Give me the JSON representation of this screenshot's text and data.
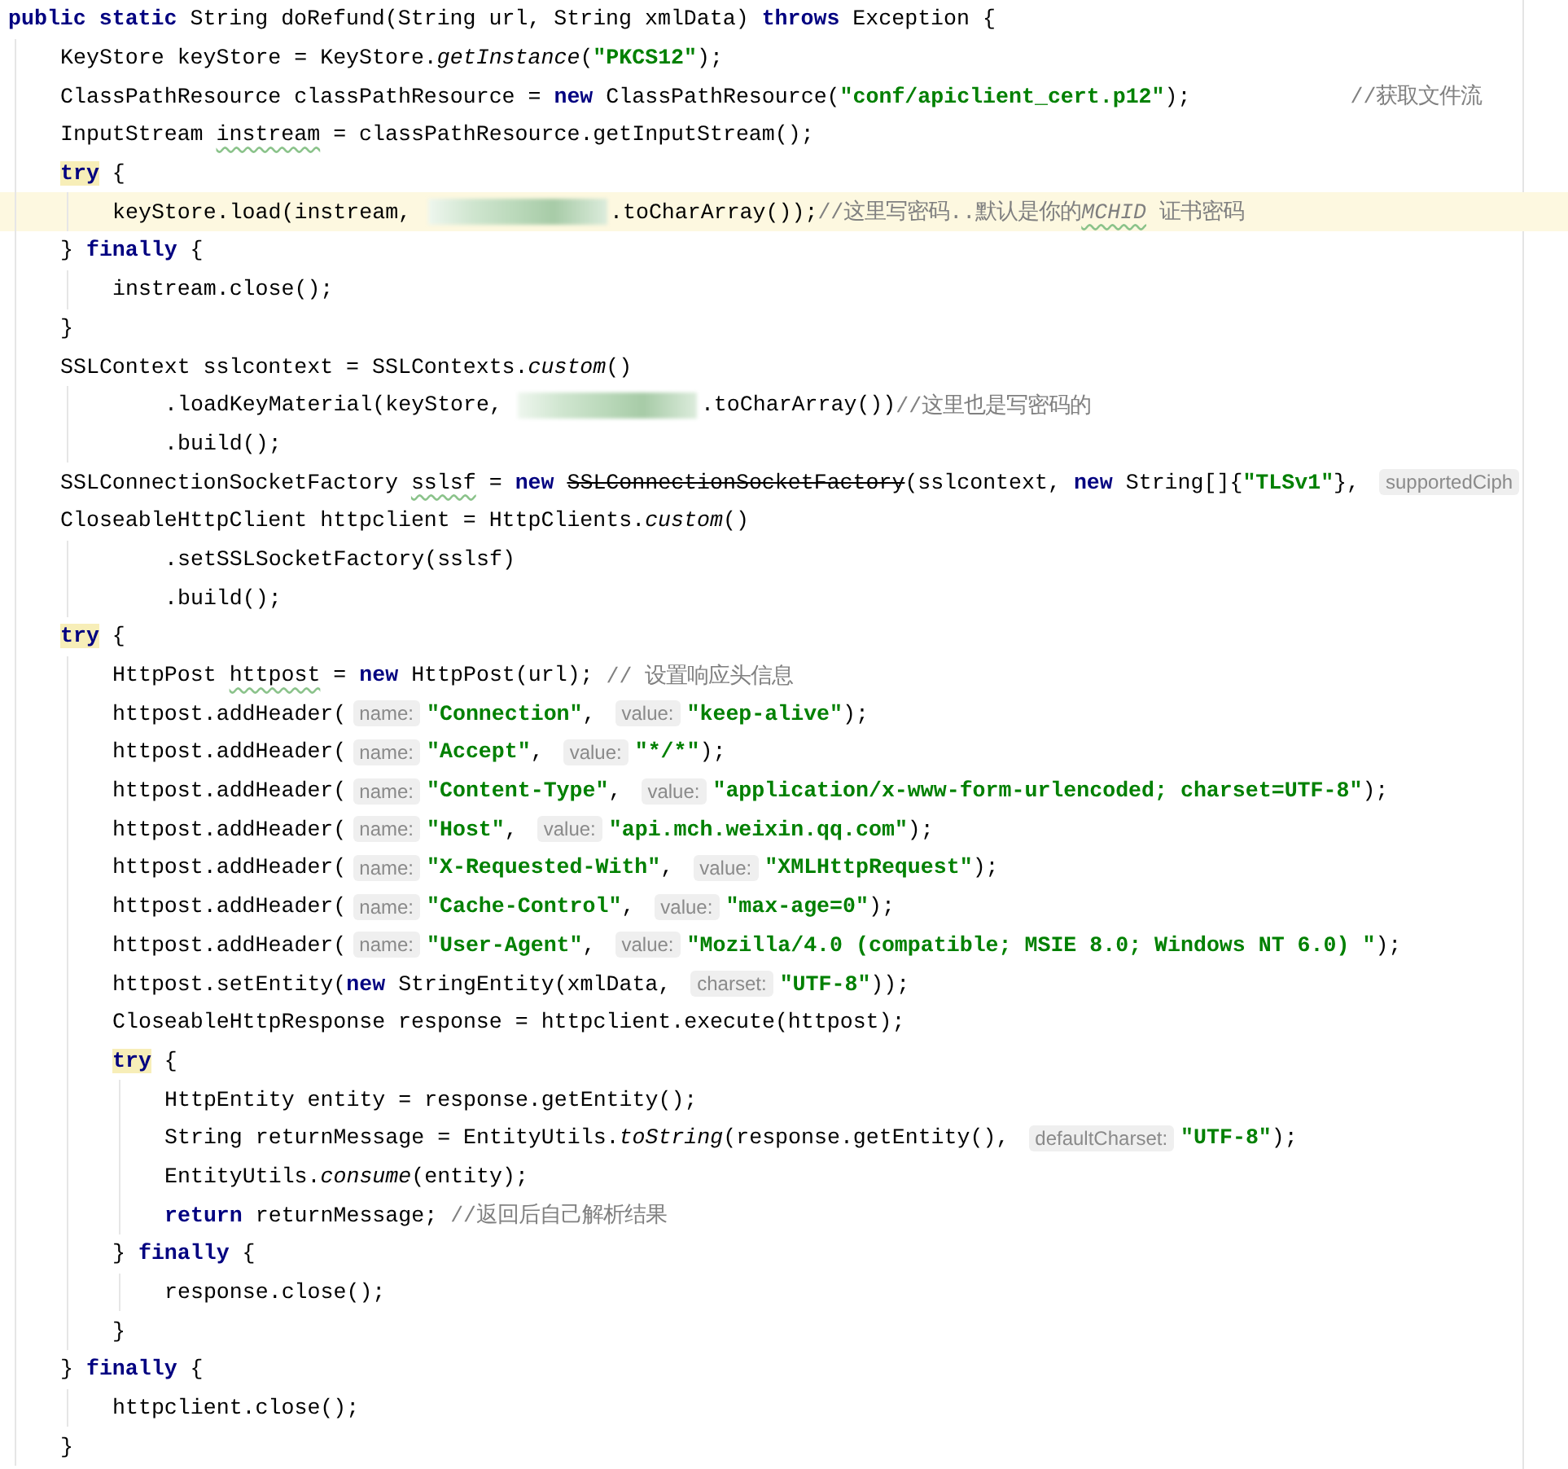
{
  "editor": {
    "lines": [
      {
        "tokens": [
          {
            "kind": "kw",
            "text": "public static"
          },
          {
            "kind": "plain",
            "text": " String doRefund(String url, String xmlData) "
          },
          {
            "kind": "kw",
            "text": "throws"
          },
          {
            "kind": "plain",
            "text": " Exception {"
          }
        ],
        "children": [
          {
            "tokens": [
              {
                "kind": "plain",
                "text": "KeyStore keyStore = KeyStore."
              },
              {
                "kind": "italic",
                "text": "getInstance"
              },
              {
                "kind": "plain",
                "text": "("
              },
              {
                "kind": "str",
                "text": "\"PKCS12\""
              },
              {
                "kind": "plain",
                "text": ");"
              }
            ]
          },
          {
            "tokens": [
              {
                "kind": "plain",
                "text": "ClassPathResource classPathResource = "
              },
              {
                "kind": "kw",
                "text": "new"
              },
              {
                "kind": "plain",
                "text": " ClassPathResource("
              },
              {
                "kind": "str",
                "text": "\"conf/apiclient_cert.p12\""
              },
              {
                "kind": "plain",
                "text": ");"
              },
              {
                "kind": "far-comment",
                "text": "//获取文件流"
              }
            ]
          },
          {
            "tokens": [
              {
                "kind": "plain",
                "text": "InputStream "
              },
              {
                "kind": "plain",
                "text": "instream",
                "squiggle": true
              },
              {
                "kind": "plain",
                "text": " = classPathResource.getInputStream();"
              }
            ]
          },
          {
            "tokens": [
              {
                "kind": "kw",
                "text": "try",
                "matched": true
              },
              {
                "kind": "plain",
                "text": " {"
              }
            ],
            "children": [
              {
                "highlighted": true,
                "tokens": [
                  {
                    "kind": "plain",
                    "text": "keyStore.load(instream, "
                  },
                  {
                    "kind": "redacted"
                  },
                  {
                    "kind": "plain",
                    "text": ".toCharArray());"
                  },
                  {
                    "kind": "comment",
                    "text": "//这里写密码..默认是你的"
                  },
                  {
                    "kind": "comment-italic",
                    "text": "MCHID",
                    "squiggle": true
                  },
                  {
                    "kind": "comment",
                    "text": " 证书密码"
                  }
                ]
              }
            ]
          },
          {
            "tokens": [
              {
                "kind": "plain",
                "text": "} "
              },
              {
                "kind": "kw",
                "text": "finally"
              },
              {
                "kind": "plain",
                "text": " {"
              }
            ],
            "children": [
              {
                "tokens": [
                  {
                    "kind": "plain",
                    "text": "instream.close();"
                  }
                ]
              }
            ]
          },
          {
            "tokens": [
              {
                "kind": "plain",
                "text": "}"
              }
            ]
          },
          {
            "tokens": [
              {
                "kind": "plain",
                "text": "SSLContext sslcontext = SSLContexts."
              },
              {
                "kind": "italic",
                "text": "custom"
              },
              {
                "kind": "plain",
                "text": "()"
              }
            ],
            "children": [
              {
                "kind": "continuation",
                "tokens": [
                  {
                    "kind": "plain",
                    "text": ".loadKeyMaterial(keyStore, "
                  },
                  {
                    "kind": "redacted"
                  },
                  {
                    "kind": "plain",
                    "text": ".toCharArray())"
                  },
                  {
                    "kind": "comment",
                    "text": "//这里也是写密码的"
                  }
                ]
              },
              {
                "kind": "continuation",
                "tokens": [
                  {
                    "kind": "plain",
                    "text": ".build();"
                  }
                ]
              }
            ]
          },
          {
            "tokens": [
              {
                "kind": "plain",
                "text": "SSLConnectionSocketFactory "
              },
              {
                "kind": "plain",
                "text": "sslsf",
                "squiggle": true
              },
              {
                "kind": "plain",
                "text": " = "
              },
              {
                "kind": "kw",
                "text": "new "
              },
              {
                "kind": "deprecated",
                "text": "SSLConnectionSocketFactory"
              },
              {
                "kind": "plain",
                "text": "(sslcontext, "
              },
              {
                "kind": "kw",
                "text": "new"
              },
              {
                "kind": "plain",
                "text": " String[]{"
              },
              {
                "kind": "str",
                "text": "\"TLSv1\""
              },
              {
                "kind": "plain",
                "text": "}, "
              },
              {
                "kind": "hint",
                "text": "supportedCiph"
              }
            ]
          },
          {
            "tokens": [
              {
                "kind": "plain",
                "text": "CloseableHttpClient httpclient = HttpClients."
              },
              {
                "kind": "italic",
                "text": "custom"
              },
              {
                "kind": "plain",
                "text": "()"
              }
            ],
            "children": [
              {
                "kind": "continuation",
                "tokens": [
                  {
                    "kind": "plain",
                    "text": ".setSSLSocketFactory(sslsf)"
                  }
                ]
              },
              {
                "kind": "continuation",
                "tokens": [
                  {
                    "kind": "plain",
                    "text": ".build();"
                  }
                ]
              }
            ]
          },
          {
            "tokens": [
              {
                "kind": "kw",
                "text": "try",
                "matched": true
              },
              {
                "kind": "plain",
                "text": " {"
              }
            ],
            "children": [
              {
                "tokens": [
                  {
                    "kind": "plain",
                    "text": "HttpPost "
                  },
                  {
                    "kind": "plain",
                    "text": "httpost",
                    "squiggle": true
                  },
                  {
                    "kind": "plain",
                    "text": " = "
                  },
                  {
                    "kind": "kw",
                    "text": "new"
                  },
                  {
                    "kind": "plain",
                    "text": " HttpPost(url); "
                  },
                  {
                    "kind": "comment",
                    "text": "// 设置响应头信息"
                  }
                ]
              },
              {
                "tokens": [
                  {
                    "kind": "plain",
                    "text": "httpost.addHeader("
                  },
                  {
                    "kind": "hint",
                    "text": "name:"
                  },
                  {
                    "kind": "str",
                    "text": "\"Connection\""
                  },
                  {
                    "kind": "plain",
                    "text": ", "
                  },
                  {
                    "kind": "hint",
                    "text": "value:"
                  },
                  {
                    "kind": "str",
                    "text": "\"keep-alive\""
                  },
                  {
                    "kind": "plain",
                    "text": ");"
                  }
                ]
              },
              {
                "tokens": [
                  {
                    "kind": "plain",
                    "text": "httpost.addHeader("
                  },
                  {
                    "kind": "hint",
                    "text": "name:"
                  },
                  {
                    "kind": "str",
                    "text": "\"Accept\""
                  },
                  {
                    "kind": "plain",
                    "text": ", "
                  },
                  {
                    "kind": "hint",
                    "text": "value:"
                  },
                  {
                    "kind": "str",
                    "text": "\"*/*\""
                  },
                  {
                    "kind": "plain",
                    "text": ");"
                  }
                ]
              },
              {
                "tokens": [
                  {
                    "kind": "plain",
                    "text": "httpost.addHeader("
                  },
                  {
                    "kind": "hint",
                    "text": "name:"
                  },
                  {
                    "kind": "str",
                    "text": "\"Content-Type\""
                  },
                  {
                    "kind": "plain",
                    "text": ", "
                  },
                  {
                    "kind": "hint",
                    "text": "value:"
                  },
                  {
                    "kind": "str",
                    "text": "\"application/x-www-form-urlencoded; charset=UTF-8\""
                  },
                  {
                    "kind": "plain",
                    "text": ");"
                  }
                ]
              },
              {
                "tokens": [
                  {
                    "kind": "plain",
                    "text": "httpost.addHeader("
                  },
                  {
                    "kind": "hint",
                    "text": "name:"
                  },
                  {
                    "kind": "str",
                    "text": "\"Host\""
                  },
                  {
                    "kind": "plain",
                    "text": ", "
                  },
                  {
                    "kind": "hint",
                    "text": "value:"
                  },
                  {
                    "kind": "str",
                    "text": "\"api.mch.weixin.qq.com\""
                  },
                  {
                    "kind": "plain",
                    "text": ");"
                  }
                ]
              },
              {
                "tokens": [
                  {
                    "kind": "plain",
                    "text": "httpost.addHeader("
                  },
                  {
                    "kind": "hint",
                    "text": "name:"
                  },
                  {
                    "kind": "str",
                    "text": "\"X-Requested-With\""
                  },
                  {
                    "kind": "plain",
                    "text": ", "
                  },
                  {
                    "kind": "hint",
                    "text": "value:"
                  },
                  {
                    "kind": "str",
                    "text": "\"XMLHttpRequest\""
                  },
                  {
                    "kind": "plain",
                    "text": ");"
                  }
                ]
              },
              {
                "tokens": [
                  {
                    "kind": "plain",
                    "text": "httpost.addHeader("
                  },
                  {
                    "kind": "hint",
                    "text": "name:"
                  },
                  {
                    "kind": "str",
                    "text": "\"Cache-Control\""
                  },
                  {
                    "kind": "plain",
                    "text": ", "
                  },
                  {
                    "kind": "hint",
                    "text": "value:"
                  },
                  {
                    "kind": "str",
                    "text": "\"max-age=0\""
                  },
                  {
                    "kind": "plain",
                    "text": ");"
                  }
                ]
              },
              {
                "tokens": [
                  {
                    "kind": "plain",
                    "text": "httpost.addHeader("
                  },
                  {
                    "kind": "hint",
                    "text": "name:"
                  },
                  {
                    "kind": "str",
                    "text": "\"User-Agent\""
                  },
                  {
                    "kind": "plain",
                    "text": ", "
                  },
                  {
                    "kind": "hint",
                    "text": "value:"
                  },
                  {
                    "kind": "str",
                    "text": "\"Mozilla/4.0 (compatible; MSIE 8.0; Windows NT 6.0) \""
                  },
                  {
                    "kind": "plain",
                    "text": ");"
                  }
                ]
              },
              {
                "tokens": [
                  {
                    "kind": "plain",
                    "text": "httpost.setEntity("
                  },
                  {
                    "kind": "kw",
                    "text": "new"
                  },
                  {
                    "kind": "plain",
                    "text": " StringEntity(xmlData, "
                  },
                  {
                    "kind": "hint",
                    "text": "charset:"
                  },
                  {
                    "kind": "str",
                    "text": "\"UTF-8\""
                  },
                  {
                    "kind": "plain",
                    "text": "));"
                  }
                ]
              },
              {
                "tokens": [
                  {
                    "kind": "plain",
                    "text": "CloseableHttpResponse response = httpclient.execute(httpost);"
                  }
                ]
              },
              {
                "tokens": [
                  {
                    "kind": "kw",
                    "text": "try",
                    "matched": true
                  },
                  {
                    "kind": "plain",
                    "text": " {"
                  }
                ],
                "children": [
                  {
                    "tokens": [
                      {
                        "kind": "plain",
                        "text": "HttpEntity entity = response.getEntity();"
                      }
                    ]
                  },
                  {
                    "tokens": [
                      {
                        "kind": "plain",
                        "text": "String returnMessage = EntityUtils."
                      },
                      {
                        "kind": "italic",
                        "text": "toString"
                      },
                      {
                        "kind": "plain",
                        "text": "(response.getEntity(), "
                      },
                      {
                        "kind": "hint",
                        "text": "defaultCharset:"
                      },
                      {
                        "kind": "str",
                        "text": "\"UTF-8\""
                      },
                      {
                        "kind": "plain",
                        "text": ");"
                      }
                    ]
                  },
                  {
                    "tokens": [
                      {
                        "kind": "plain",
                        "text": "EntityUtils."
                      },
                      {
                        "kind": "italic",
                        "text": "consume"
                      },
                      {
                        "kind": "plain",
                        "text": "(entity);"
                      }
                    ]
                  },
                  {
                    "tokens": [
                      {
                        "kind": "kw",
                        "text": "return"
                      },
                      {
                        "kind": "plain",
                        "text": " returnMessage; "
                      },
                      {
                        "kind": "comment",
                        "text": "//返回后自己解析结果"
                      }
                    ]
                  }
                ]
              },
              {
                "tokens": [
                  {
                    "kind": "plain",
                    "text": "} "
                  },
                  {
                    "kind": "kw",
                    "text": "finally"
                  },
                  {
                    "kind": "plain",
                    "text": " {"
                  }
                ],
                "children": [
                  {
                    "tokens": [
                      {
                        "kind": "plain",
                        "text": "response.close();"
                      }
                    ]
                  }
                ]
              },
              {
                "tokens": [
                  {
                    "kind": "plain",
                    "text": "}"
                  }
                ]
              }
            ]
          },
          {
            "tokens": [
              {
                "kind": "plain",
                "text": "} "
              },
              {
                "kind": "kw",
                "text": "finally"
              },
              {
                "kind": "plain",
                "text": " {"
              }
            ],
            "children": [
              {
                "tokens": [
                  {
                    "kind": "plain",
                    "text": "httpclient.close();"
                  }
                ]
              }
            ]
          },
          {
            "tokens": [
              {
                "kind": "plain",
                "text": "}"
              }
            ]
          }
        ]
      }
    ]
  }
}
